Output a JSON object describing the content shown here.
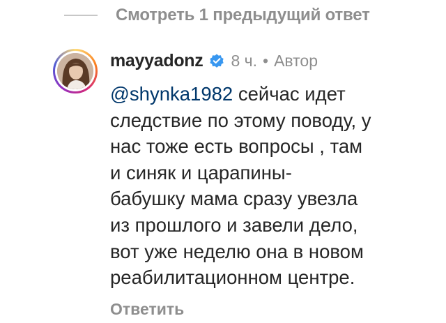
{
  "replies": {
    "view_previous_label": "Смотреть 1 предыдущий ответ"
  },
  "comment": {
    "username": "mayyadonz",
    "verified_icon": "verified-badge-icon",
    "time": "8 ч.",
    "separator": "•",
    "author_badge": "Автор",
    "mention": "@shynka1982",
    "text_lines": [
      "сейчас идет",
      "следствие по этому поводу, у",
      "нас тоже есть вопросы , там",
      "и синяк и царапины-",
      "бабушку мама сразу увезла",
      "из прошлого и завели дело,",
      "вот уже неделю она в новом",
      "реабилитационном центре."
    ],
    "reply_label": "Ответить"
  },
  "colors": {
    "primary_text": "#262626",
    "secondary_text": "#8e8e8e",
    "mention": "#00376b",
    "verified": "#3897f0"
  }
}
